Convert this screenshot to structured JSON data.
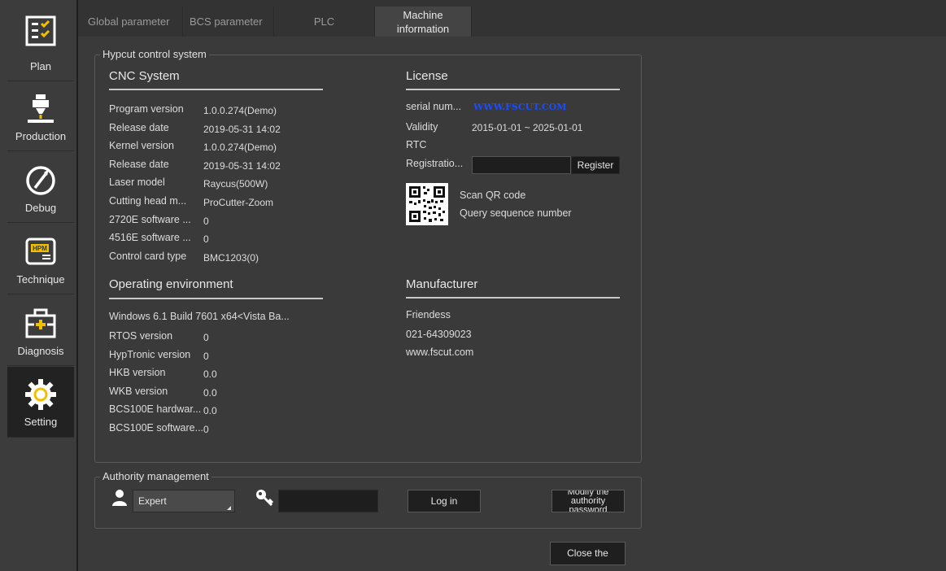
{
  "sidebar": {
    "items": [
      {
        "label": "Plan",
        "icon": "plan-icon"
      },
      {
        "label": "Production",
        "icon": "production-icon"
      },
      {
        "label": "Debug",
        "icon": "debug-icon"
      },
      {
        "label": "Technique",
        "icon": "technique-icon"
      },
      {
        "label": "Diagnosis",
        "icon": "diagnosis-icon"
      },
      {
        "label": "Setting",
        "icon": "gear-icon"
      }
    ],
    "active": "Setting"
  },
  "tabs": [
    "Global parameter",
    "BCS parameter",
    "PLC",
    "Machine information"
  ],
  "hypcut": {
    "group_title": "Hypcut control system",
    "cnc_title": "CNC System",
    "cnc_rows": [
      {
        "label": "Program version",
        "value": "1.0.0.274(Demo)"
      },
      {
        "label": "Release date",
        "value": "2019-05-31 14:02"
      },
      {
        "label": "Kernel version",
        "value": "1.0.0.274(Demo)"
      },
      {
        "label": "Release date",
        "value": "2019-05-31 14:02"
      },
      {
        "label": "Laser model",
        "value": "Raycus(500W)"
      },
      {
        "label": "Cutting head m...",
        "value": "ProCutter-Zoom"
      },
      {
        "label": "2720E software ...",
        "value": "0"
      },
      {
        "label": "4516E software ...",
        "value": "0"
      },
      {
        "label": "Control card type",
        "value": "BMC1203(0)"
      }
    ],
    "env_title": "Operating environment",
    "env_os": "Windows 6.1 Build 7601 x64<Vista Ba...",
    "env_rows": [
      {
        "label": "RTOS version",
        "value": "0"
      },
      {
        "label": "HypTronic version",
        "value": "0"
      },
      {
        "label": "HKB version",
        "value": "0.0"
      },
      {
        "label": "WKB version",
        "value": "0.0"
      },
      {
        "label": "BCS100E hardwar...",
        "value": "0.0"
      },
      {
        "label": "BCS100E software...",
        "value": "0"
      }
    ],
    "license_title": "License",
    "serial_label": "serial num...",
    "serial_value": "WWW.FSCUT.COM",
    "validity_label": "Validity",
    "validity_value": "2015-01-01 ~ 2025-01-01",
    "rtc_label": "RTC",
    "registration_label": "Registratio...",
    "registration_value": "",
    "register_button": "Register",
    "scan_qr": "Scan QR code",
    "query_seq": "Query sequence number",
    "manufacturer_title": "Manufacturer",
    "manufacturer_name": "Friendess",
    "manufacturer_phone": "021-64309023",
    "manufacturer_web": "www.fscut.com"
  },
  "authority": {
    "group_title": "Authority management",
    "user_level": "Expert",
    "password_value": "",
    "login_button": "Log in",
    "modify_button": "Modify the authority password"
  },
  "close_button": "Close the system",
  "colors": {
    "background": "#3a3a3a",
    "sidebar_active": "#222222",
    "serial_link": "#1a4dff"
  }
}
